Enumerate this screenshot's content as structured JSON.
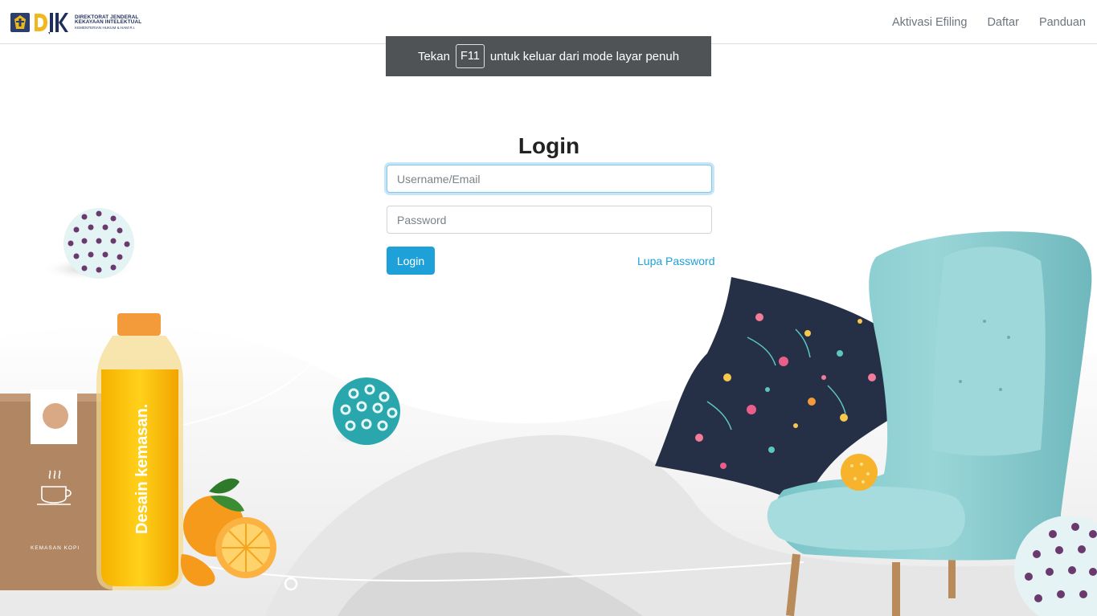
{
  "brand": {
    "line1": "DIREKTORAT JENDERAL",
    "line2": "KEKAYAAN INTELEKTUAL",
    "line3": "KEMENTERIAN HUKUM & HAM R.I."
  },
  "nav": {
    "items": [
      {
        "label": "Aktivasi Efiling"
      },
      {
        "label": "Daftar"
      },
      {
        "label": "Panduan"
      }
    ]
  },
  "fullscreen_notice": {
    "prefix": "Tekan",
    "key": "F11",
    "suffix": "untuk keluar dari mode layar penuh"
  },
  "login": {
    "title": "Login",
    "username_placeholder": "Username/Email",
    "password_placeholder": "Password",
    "submit_label": "Login",
    "forgot_label": "Lupa Password"
  },
  "illustration": {
    "bottle_text": "Desain kemasan.",
    "pouch_text": "KEMASAN KOPI"
  },
  "colors": {
    "accent": "#1ea1d9",
    "chair": "#8fd0d3",
    "notice_bg": "#505355"
  },
  "icons": [
    "emblem-icon",
    "djki-logo-icon",
    "coffee-cup-icon"
  ]
}
